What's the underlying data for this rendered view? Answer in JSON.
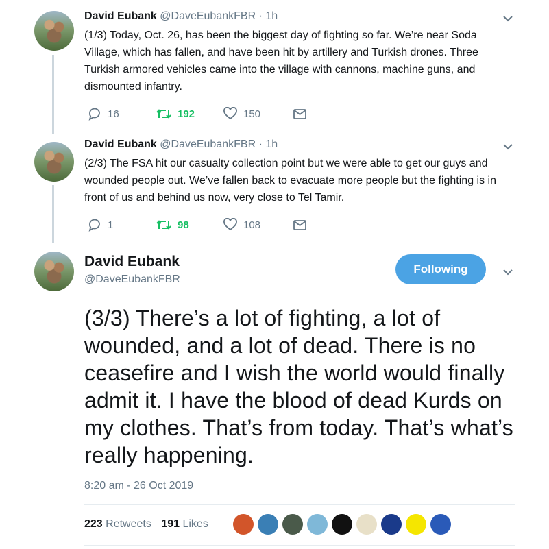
{
  "tweets": [
    {
      "name": "David Eubank",
      "handle": "@DaveEubankFBR",
      "dot": "·",
      "time": "1h",
      "text": "(1/3) Today, Oct. 26, has been the biggest day of fighting so far. We’re near Soda Village, which has fallen, and have been hit by artillery and Turkish drones. Three Turkish armored vehicles came into the village with cannons, machine guns, and dismounted infantry.",
      "replies": "16",
      "retweets": "192",
      "likes": "150"
    },
    {
      "name": "David Eubank",
      "handle": "@DaveEubankFBR",
      "dot": "·",
      "time": "1h",
      "text": "(2/3) The FSA hit our casualty collection point but we were able to get our guys and wounded people out. We’ve fallen back to evacuate more people but the fighting is in front of us and behind us now, very close to Tel Tamir.",
      "replies": "1",
      "retweets": "98",
      "likes": "108"
    }
  ],
  "main_tweet": {
    "name": "David Eubank",
    "handle": "@DaveEubankFBR",
    "follow_label": "Following",
    "text": "(3/3) There’s a lot of fighting, a lot of wounded, and a lot of dead. There is no ceasefire and I wish the world would finally admit it. I have the blood of dead Kurds on my clothes. That’s from today. That’s what’s really happening.",
    "timestamp": "8:20 am - 26 Oct 2019",
    "retweets_count": "223",
    "retweets_label": "Retweets",
    "likes_count": "191",
    "likes_label": "Likes"
  },
  "colors": {
    "accent": "#4ba3e4",
    "retweet_green": "#17bf63",
    "muted": "#657786",
    "text": "#14171a"
  },
  "liker_avatars": [
    "#d2552a",
    "#3a7fb5",
    "#4a5a4a",
    "#7fb8d8",
    "#111111",
    "#e8e0c8",
    "#1a3a8a",
    "#f5e600",
    "#2a5ab8"
  ]
}
